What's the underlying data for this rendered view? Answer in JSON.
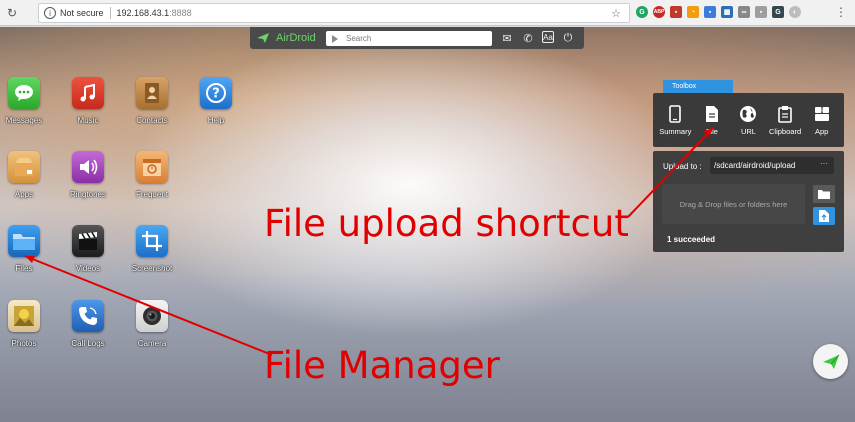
{
  "browser": {
    "security_label": "Not secure",
    "url_host": "192.168.43.1",
    "url_port": ":8888"
  },
  "airdroid": {
    "logo_text": "AirDroid",
    "search_placeholder": "Search",
    "accent_color": "#6dd36d"
  },
  "apps": [
    {
      "label": "Messages",
      "icon": "messages-icon"
    },
    {
      "label": "Music",
      "icon": "music-icon"
    },
    {
      "label": "Contacts",
      "icon": "contacts-icon"
    },
    {
      "label": "Help",
      "icon": "help-icon"
    },
    {
      "label": "Apps",
      "icon": "apps-icon"
    },
    {
      "label": "Ringtones",
      "icon": "ringtones-icon"
    },
    {
      "label": "Frequent",
      "icon": "frequent-icon"
    },
    {
      "label": "Files",
      "icon": "folder-icon"
    },
    {
      "label": "Videos",
      "icon": "videos-icon"
    },
    {
      "label": "Screenshot",
      "icon": "screenshot-icon"
    },
    {
      "label": "Photos",
      "icon": "photos-icon"
    },
    {
      "label": "Call Logs",
      "icon": "call-logs-icon"
    },
    {
      "label": "Camera",
      "icon": "camera-icon"
    }
  ],
  "toolbox": {
    "title": "Toolbox",
    "tools": [
      {
        "label": "Summary",
        "icon": "phone-icon"
      },
      {
        "label": "File",
        "icon": "file-icon"
      },
      {
        "label": "URL",
        "icon": "globe-icon"
      },
      {
        "label": "Clipboard",
        "icon": "clipboard-icon"
      },
      {
        "label": "App",
        "icon": "app-grid-icon"
      }
    ],
    "upload_label": "Upload to :",
    "upload_path": "/sdcard/airdroid/upload",
    "more": "···",
    "dropzone_text": "Drag & Drop files or folders here",
    "status": "1 succeeded",
    "accent_color": "#2f93e0"
  },
  "annotations": {
    "upload_shortcut": "File upload shortcut",
    "file_manager": "File Manager",
    "color": "#e00000"
  }
}
